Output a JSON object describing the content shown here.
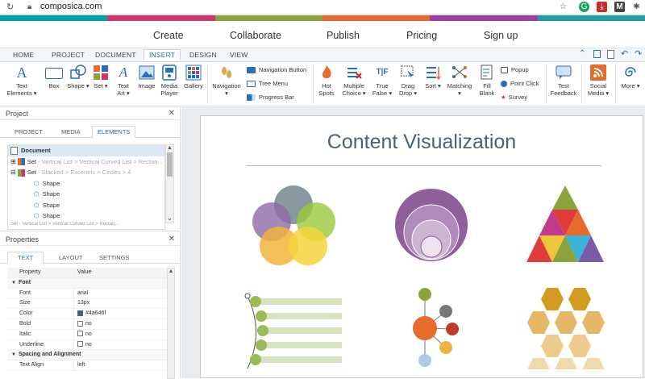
{
  "browser": {
    "url": "composica.com"
  },
  "site_nav": [
    "Create",
    "Collaborate",
    "Publish",
    "Pricing",
    "Sign up"
  ],
  "ribbon_tabs": [
    "HOME",
    "PROJECT",
    "DOCUMENT",
    "INSERT",
    "DESIGN",
    "VIEW"
  ],
  "ribbon": {
    "text_elements": "Text Elements ▾",
    "box": "Box",
    "shape": "Shape ▾",
    "set": "Set ▾",
    "text_art": "Text Art ▾",
    "image": "Image",
    "media_player": "Media Player",
    "gallery": "Gallery",
    "navigation": "Navigation ▾",
    "nav_button": "Navigation Button",
    "tree_menu": "Tree Menu",
    "progress_bar": "Progress Bar",
    "hot_spots": "Hot Spots",
    "multiple_choice": "Multiple Choice ▾",
    "true_false": "True False ▾",
    "drag_drop": "Drag Drop ▾",
    "sort": "Sort ▾",
    "matching": "Matching ▾",
    "fill_blank": "Fill Blank",
    "popup": "Popup",
    "point_click": "Point Click",
    "survey": "Survey",
    "test_feedback": "Test Feedback",
    "social_media": "Social Media ▾",
    "more": "More ▾"
  },
  "project_panel": {
    "title": "Project",
    "tabs": [
      "PROJECT",
      "MEDIA",
      "ELEMENTS"
    ],
    "tree": {
      "document": "Document",
      "set1_name": "Set",
      "set1_path": " - Vertical List > Vertical Curved List > Rectan...",
      "set2_name": "Set",
      "set2_path": " - Stacked > Excentric > Circles > 4",
      "shapes": [
        "Shape",
        "Shape",
        "Shape",
        "Shape"
      ],
      "cut_row": "Set - Vertical List > Vertical Curved List > Rectan..."
    }
  },
  "properties_panel": {
    "title": "Properties",
    "tabs": [
      "TEXT",
      "LAYOUT",
      "SETTINGS"
    ],
    "col_property": "Property",
    "col_value": "Value",
    "group_font": "Font",
    "font_rows": [
      {
        "k": "Font",
        "v": "arial"
      },
      {
        "k": "Size",
        "v": "13px"
      },
      {
        "k": "Color",
        "v": "#4a646f"
      },
      {
        "k": "Bold",
        "v": "no"
      },
      {
        "k": "Italic",
        "v": "no"
      },
      {
        "k": "Underline",
        "v": "no"
      }
    ],
    "group_spacing": "Spacing and Alignment",
    "text_align_label": "Text Align",
    "text_align_value": "left"
  },
  "canvas": {
    "title": "Content Visualization"
  },
  "colors": {
    "accent": "#2a6ebb",
    "title": "#4a646f"
  }
}
